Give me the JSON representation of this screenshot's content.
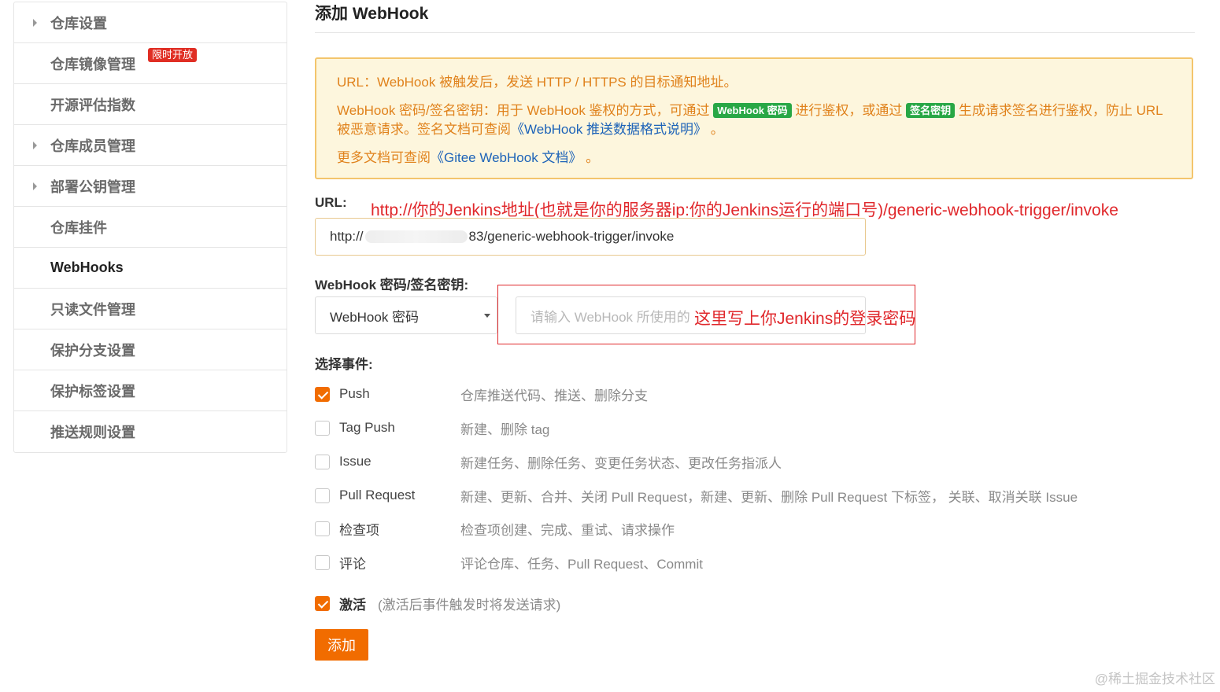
{
  "sidebar": {
    "items": [
      {
        "label": "仓库设置",
        "caret": true
      },
      {
        "label": "仓库镜像管理",
        "caret": false,
        "badge": "限时开放"
      },
      {
        "label": "开源评估指数",
        "caret": false
      },
      {
        "label": "仓库成员管理",
        "caret": true
      },
      {
        "label": "部署公钥管理",
        "caret": true
      },
      {
        "label": "仓库挂件",
        "caret": false
      },
      {
        "label": "WebHooks",
        "caret": false,
        "active": true
      },
      {
        "label": "只读文件管理",
        "caret": false
      },
      {
        "label": "保护分支设置",
        "caret": false
      },
      {
        "label": "保护标签设置",
        "caret": false
      },
      {
        "label": "推送规则设置",
        "caret": false
      }
    ]
  },
  "main": {
    "title": "添加 WebHook",
    "notice": {
      "line1": "URL：WebHook 被触发后，发送 HTTP / HTTPS 的目标通知地址。",
      "line2_a": "WebHook 密码/签名密钥：用于 WebHook 鉴权的方式，可通过",
      "line2_tag1": "WebHook 密码",
      "line2_b": "进行鉴权，或通过",
      "line2_tag2": "签名密钥",
      "line2_c": "生成请求签名进行鉴权，防止 URL 被恶意请求。签名文档可查阅",
      "line2_link": "《WebHook 推送数据格式说明》",
      "line2_d": "。",
      "line3_a": "更多文档可查阅",
      "line3_link": "《Gitee WebHook 文档》",
      "line3_b": "。"
    },
    "url_label": "URL:",
    "url_annotation": "http://你的Jenkins地址(也就是你的服务器ip:你的Jenkins运行的端口号)/generic-webhook-trigger/invoke",
    "url_value_prefix": "http://",
    "url_value_suffix": "83/generic-webhook-trigger/invoke",
    "secret_label": "WebHook 密码/签名密钥:",
    "secret_type": "WebHook 密码",
    "secret_placeholder": "请输入 WebHook 所使用的",
    "secret_annotation": "这里写上你Jenkins的登录密码",
    "events_label": "选择事件:",
    "events": [
      {
        "name": "Push",
        "desc": "仓库推送代码、推送、删除分支",
        "checked": true
      },
      {
        "name": "Tag Push",
        "desc": "新建、删除 tag",
        "checked": false
      },
      {
        "name": "Issue",
        "desc": "新建任务、删除任务、变更任务状态、更改任务指派人",
        "checked": false
      },
      {
        "name": "Pull Request",
        "desc": "新建、更新、合并、关闭 Pull Request，新建、更新、删除 Pull Request 下标签， 关联、取消关联 Issue",
        "checked": false
      },
      {
        "name": "检查项",
        "desc": "检查项创建、完成、重试、请求操作",
        "checked": false
      },
      {
        "name": "评论",
        "desc": "评论仓库、任务、Pull Request、Commit",
        "checked": false
      }
    ],
    "activate_label": "激活",
    "activate_hint": "(激活后事件触发时将发送请求)",
    "activate_checked": true,
    "add_button": "添加"
  },
  "watermark": "@稀土掘金技术社区",
  "colors": {
    "accent": "#f16c00",
    "notice_text": "#e0821c",
    "annotation": "#e0282c",
    "badge": "#e02e24"
  }
}
